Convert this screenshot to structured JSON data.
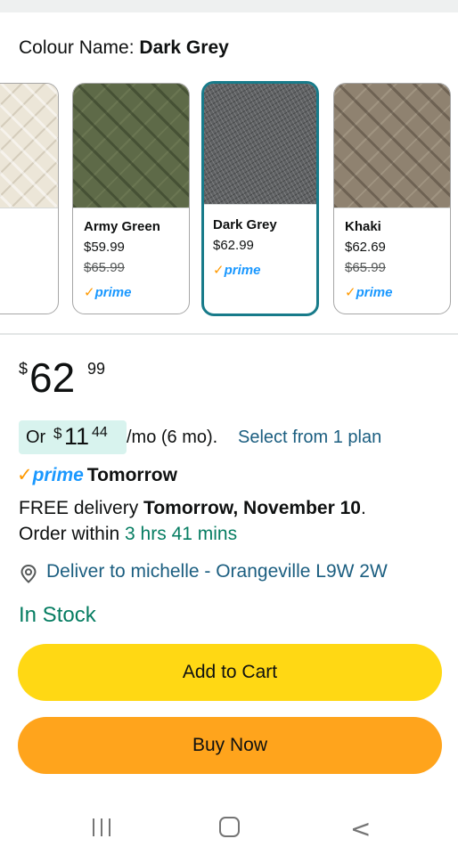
{
  "colour": {
    "label": "Colour Name:",
    "selected": "Dark Grey"
  },
  "swatches": [
    {
      "name": "",
      "price": "",
      "was": "",
      "prime": ""
    },
    {
      "name": "Army Green",
      "price": "$59.99",
      "was": "$65.99",
      "prime": "prime"
    },
    {
      "name": "Dark Grey",
      "price": "$62.99",
      "was": "",
      "prime": "prime"
    },
    {
      "name": "Khaki",
      "price": "$62.69",
      "was": "$65.99",
      "prime": "prime"
    }
  ],
  "price": {
    "symbol": "$",
    "whole": "62",
    "fraction": "99"
  },
  "installment": {
    "or": "Or",
    "symbol": "$",
    "whole": "11",
    "fraction": "44",
    "term": "/mo (6 mo).",
    "link": "Select from 1 plan"
  },
  "prime": {
    "check": "✓",
    "word": "prime",
    "when": "Tomorrow"
  },
  "delivery": {
    "free_text": "FREE delivery",
    "date": "Tomorrow, November 10",
    "period": ".",
    "order_within": "Order within",
    "countdown": "3 hrs 41 mins"
  },
  "deliver_to": "Deliver to michelle - Orangeville L9W 2W",
  "stock": "In Stock",
  "buttons": {
    "add_to_cart": "Add to Cart",
    "buy_now": "Buy Now"
  },
  "colors": {
    "selected_border": "#187b8a",
    "add_to_cart": "#ffd814",
    "buy_now": "#ffa41c",
    "prime_blue": "#1a98ff",
    "stock_green": "#067d62",
    "link_blue": "#1b5e80"
  },
  "icons": {
    "location": "location-pin-icon",
    "prime_check": "checkmark-icon",
    "nav_recent": "recent-apps-icon",
    "nav_home": "home-icon",
    "nav_back": "back-icon"
  }
}
